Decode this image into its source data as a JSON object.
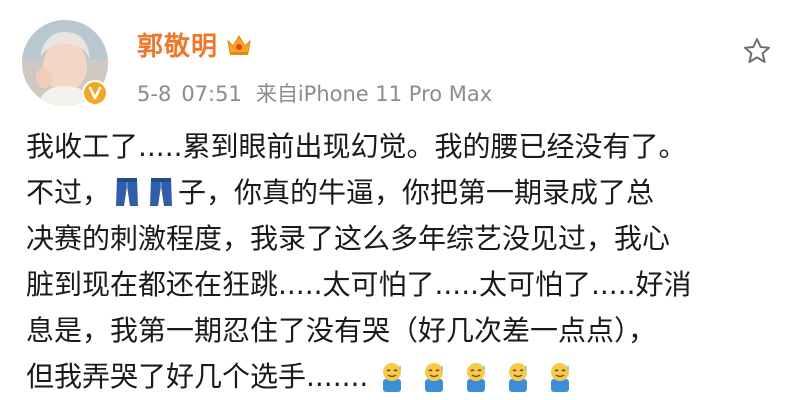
{
  "post": {
    "author": "郭敬明",
    "date": "5-8",
    "time": "07:51",
    "source": "来自iPhone 11 Pro Max",
    "lines": {
      "l1": "我收工了.....累到眼前出现幻觉。我的腰已经没有了。",
      "l2_pre": "不过，",
      "l2_post": "子，你真的牛逼，你把第一期录成了总",
      "l3": "决赛的刺激程度，我录了这么多年综艺没见过，我心",
      "l4": "脏到现在都还在狂跳.....太可怕了.....太可怕了.....好消",
      "l5": "息是，我第一期忍住了没有哭（好几次差一点点），",
      "l6": "但我弄哭了好几个选手......."
    },
    "icons": {
      "crown": "crown-icon",
      "verified": "verified-v-icon",
      "favorite": "star-icon",
      "jeans": "jeans-icon",
      "emoji": "sweat-smile-emoji-icon"
    },
    "colors": {
      "username": "#f0762a",
      "meta": "#8c8c8c",
      "text": "#1a1a1a",
      "verified": "#f5a623"
    }
  }
}
